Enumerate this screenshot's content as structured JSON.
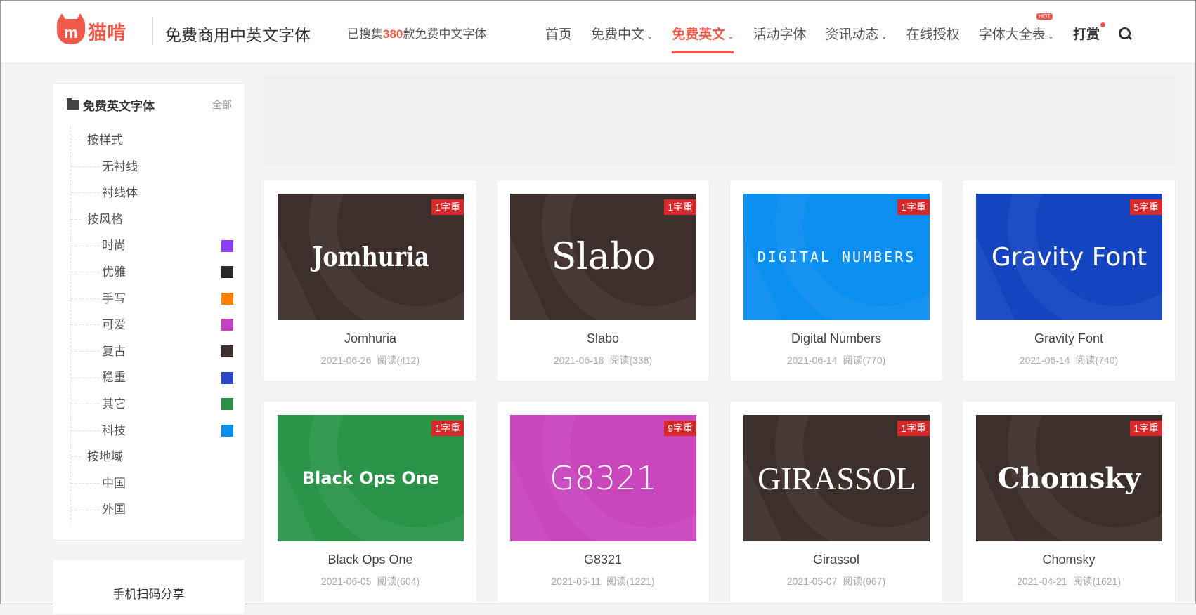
{
  "header": {
    "logo_text": "猫啃",
    "site_title": "免费商用中英文字体",
    "collected_prefix": "已搜集",
    "collected_count": "380",
    "collected_suffix": "款免费中文字体",
    "nav": [
      {
        "label": "首页"
      },
      {
        "label": "免费中文",
        "dropdown": true
      },
      {
        "label": "免费英文",
        "dropdown": true,
        "active": true
      },
      {
        "label": "活动字体"
      },
      {
        "label": "资讯动态",
        "dropdown": true
      },
      {
        "label": "在线授权"
      },
      {
        "label": "字体大全表",
        "dropdown": true,
        "badge": "HOT"
      },
      {
        "label": "打赏",
        "dot": true
      }
    ]
  },
  "sidebar": {
    "title": "免费英文字体",
    "all_link": "全部",
    "tree": [
      {
        "label": "按样式"
      },
      {
        "label": "无衬线",
        "sub": true
      },
      {
        "label": "衬线体",
        "sub": true
      },
      {
        "label": "按风格"
      },
      {
        "label": "时尚",
        "sub": true,
        "color": "#8a3ff5"
      },
      {
        "label": "优雅",
        "sub": true,
        "color": "#2a2a2e"
      },
      {
        "label": "手写",
        "sub": true,
        "color": "#ff8000"
      },
      {
        "label": "可爱",
        "sub": true,
        "color": "#c542c0"
      },
      {
        "label": "复古",
        "sub": true,
        "color": "#3d2f2c"
      },
      {
        "label": "稳重",
        "sub": true,
        "color": "#2848c8"
      },
      {
        "label": "其它",
        "sub": true,
        "color": "#2f8f44"
      },
      {
        "label": "科技",
        "sub": true,
        "color": "#0a8ef0"
      },
      {
        "label": "按地域"
      },
      {
        "label": "中国",
        "sub": true
      },
      {
        "label": "外国",
        "sub": true
      }
    ],
    "share_title": "手机扫码分享"
  },
  "cards": [
    {
      "name": "Jomhuria",
      "tag": "1字重",
      "date": "2021-06-26",
      "reads": "阅读(412)",
      "bg": "#3d2f2c"
    },
    {
      "name": "Slabo",
      "tag": "1字重",
      "date": "2021-06-18",
      "reads": "阅读(338)",
      "bg": "#3d2f2c"
    },
    {
      "name": "Digital Numbers",
      "sample": "DIGITAL NUMBERS",
      "tag": "1字重",
      "date": "2021-06-14",
      "reads": "阅读(770)",
      "bg": "#0a8ef0"
    },
    {
      "name": "Gravity Font",
      "tag": "5字重",
      "date": "2021-06-14",
      "reads": "阅读(740)",
      "bg": "#1444c0"
    },
    {
      "name": "Black Ops One",
      "tag": "1字重",
      "date": "2021-06-05",
      "reads": "阅读(604)",
      "bg": "#2a9448"
    },
    {
      "name": "G8321",
      "tag": "9字重",
      "date": "2021-05-11",
      "reads": "阅读(1221)",
      "bg": "#c946bd"
    },
    {
      "name": "Girassol",
      "sample": "GIRASSOL",
      "tag": "1字重",
      "date": "2021-05-07",
      "reads": "阅读(967)",
      "bg": "#3d2f2c"
    },
    {
      "name": "Chomsky",
      "tag": "1字重",
      "date": "2021-04-21",
      "reads": "阅读(1621)",
      "bg": "#3d2f2c"
    }
  ]
}
